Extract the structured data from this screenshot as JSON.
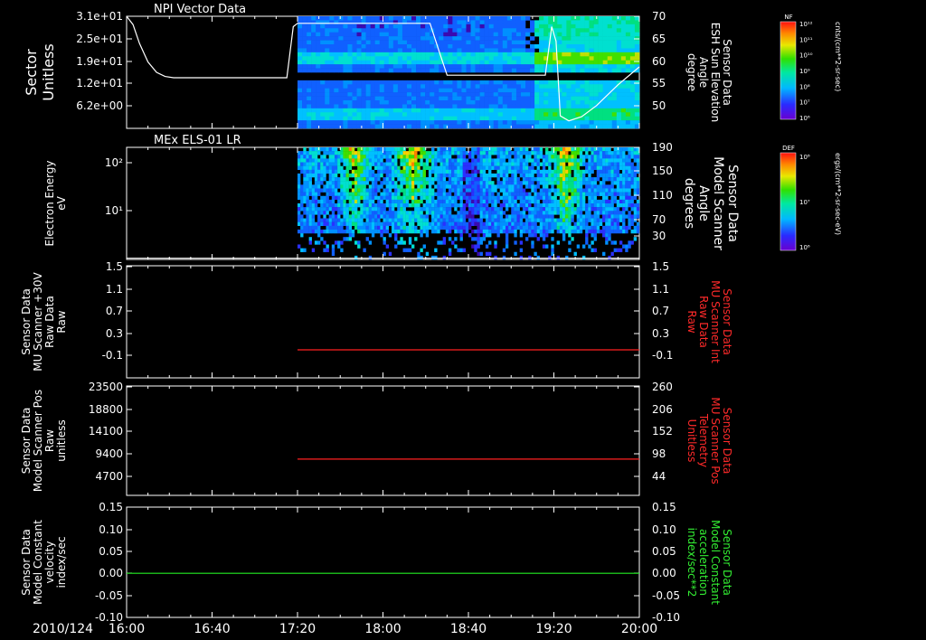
{
  "time_axis": {
    "date_label": "2010/124",
    "ticks": [
      "16:00",
      "16:40",
      "17:20",
      "18:00",
      "18:40",
      "19:20",
      "20:00"
    ],
    "range_min": [
      0,
      240
    ]
  },
  "colors": {
    "line_white": "#ffffff",
    "line_red": "#ff2020",
    "line_green": "#22ee22",
    "label_red": "#ff2a2a",
    "label_green": "#33ee33"
  },
  "chart_data": [
    {
      "type": "heatmap",
      "title": "NPI Vector Data",
      "ylabel": [
        "Sector",
        "Unitless"
      ],
      "yticks": [
        "3.1e+01",
        "2.5e+01",
        "1.9e+01",
        "1.2e+01",
        "6.2e+00"
      ],
      "y2label": [
        "Sensor Data",
        "ESH Sun Elevation",
        "Angle",
        "degree"
      ],
      "y2ticks": [
        "70",
        "65",
        "60",
        "55",
        "50"
      ],
      "y2lim": [
        43,
        70
      ],
      "heatmap": {
        "data_start_min": 80,
        "data_end_min": 240,
        "gap_bands": [
          [
            0.5,
            0.52
          ]
        ]
      },
      "colorbar": {
        "name": "NF",
        "unit": "cnts/(cm**2-sr-sec)",
        "ticks": [
          "10¹²",
          "10¹¹",
          "10¹⁰",
          "10⁹",
          "10⁸",
          "10⁷",
          "10⁶"
        ]
      },
      "series": [
        {
          "type": "line",
          "x": [
            0,
            3,
            6,
            10,
            14,
            18,
            22,
            27,
            40,
            60,
            75,
            78,
            80,
            100,
            120,
            142,
            146,
            150,
            160,
            180,
            190,
            196,
            199,
            201,
            203,
            207,
            213,
            220,
            230,
            240
          ],
          "y": [
            70,
            68,
            63.5,
            59,
            56.5,
            55.5,
            55.2,
            55.2,
            55.2,
            55.2,
            55.2,
            67.5,
            68.3,
            68.3,
            68.3,
            68.3,
            62,
            55.8,
            55.8,
            55.8,
            55.8,
            55.8,
            67.5,
            64,
            46,
            44.8,
            45.8,
            48.5,
            53.5,
            57.8
          ]
        }
      ]
    },
    {
      "type": "heatmap",
      "title": "MEx ELS-01 LR",
      "ylabel": [
        "Electron Energy",
        "eV"
      ],
      "yticks": [
        "10²",
        "10¹"
      ],
      "y2label": [
        "Sensor Data",
        "Model Scanner",
        "Angle",
        "degrees"
      ],
      "y2ticks": [
        "190",
        "150",
        "110",
        "70",
        "30"
      ],
      "y2lim": [
        10,
        190
      ],
      "heatmap": {
        "data_start_min": 80,
        "data_end_min": 240,
        "hot_spots_min": [
          [
            97,
            115
          ],
          [
            122,
            145
          ],
          [
            195,
            215
          ]
        ]
      },
      "colorbar": {
        "name": "DEF",
        "unit": "ergs/(cm**2-sr-sec-eV)",
        "ticks": [
          "10⁸",
          "10⁷",
          "10⁶"
        ]
      },
      "series": [
        {
          "type": "line",
          "x": [
            0,
            240
          ],
          "y": [
            12,
            12
          ]
        }
      ]
    },
    {
      "type": "line",
      "ylabel": [
        "Sensor Data",
        "MU Scanner +30V",
        "Raw Data",
        "Raw"
      ],
      "yticks": [
        "1.5",
        "1.1",
        "0.7",
        "0.3",
        "-0.1"
      ],
      "ylim": [
        -0.5,
        1.5
      ],
      "y2label": [
        "Sensor Data",
        "MU Scanner Int",
        "Raw Data",
        "Raw"
      ],
      "y2ticks": [
        "1.5",
        "1.1",
        "0.7",
        "0.3",
        "-0.1"
      ],
      "series": [
        {
          "x": [
            80,
            240
          ],
          "y": [
            0.0,
            0.0
          ]
        }
      ]
    },
    {
      "type": "line",
      "ylabel": [
        "Sensor Data",
        "Model Scanner Pos",
        "Raw",
        "unitless"
      ],
      "yticks": [
        "23500",
        "18800",
        "14100",
        "9400",
        "4700"
      ],
      "ylim": [
        0,
        23500
      ],
      "y2label": [
        "Sensor Data",
        "MU Scanner Pos",
        "Telemetry",
        "Unitless"
      ],
      "y2ticks": [
        "260",
        "206",
        "152",
        "98",
        "44"
      ],
      "series": [
        {
          "x": [
            80,
            240
          ],
          "y": [
            7800,
            7800
          ]
        }
      ]
    },
    {
      "type": "line",
      "ylabel": [
        "Sensor Data",
        "Model Constant",
        "velocity",
        "index/sec"
      ],
      "yticks": [
        "0.15",
        "0.10",
        "0.05",
        "0.00",
        "-0.05",
        "-0.10"
      ],
      "ylim": [
        -0.1,
        0.15
      ],
      "y2label": [
        "Sensor Data",
        "Model Constant",
        "acceleration",
        "index/sec**2"
      ],
      "y2ticks": [
        "0.15",
        "0.10",
        "0.05",
        "0.00",
        "-0.05",
        "-0.10"
      ],
      "series": [
        {
          "x": [
            0,
            240
          ],
          "y": [
            0.0,
            0.0
          ]
        }
      ]
    }
  ]
}
